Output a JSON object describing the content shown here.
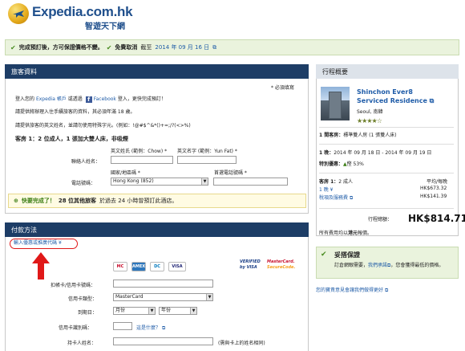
{
  "header": {
    "logo_text": "Expedia.com.hk",
    "logo_tagline": "智遊天下網"
  },
  "confirm_bar": {
    "text1": "完成預訂後，方可保證價格不變。",
    "text2": "免費取消",
    "text3": "截至",
    "date": "2014 年 09 月 16 日"
  },
  "traveler": {
    "heading": "旅客資料",
    "required_note": "* 必須填寫",
    "signin_prefix": "登入您的",
    "signin_expedia": "Expedia 帳戶",
    "signin_mid": "或透過",
    "signin_facebook": "Facebook",
    "signin_suffix": "登入，更快完成預訂！",
    "note1": "請提供將辦理入住手續旅客的資料，其必須年滿 18 歲。",
    "note2": "請提供旅客的英文姓名，並請勿使用特殊字元。(例如：!@#$^&*()+=;/?(<>%)",
    "guest_line": "客房 1：2 位成人，1 張加大雙人床，非吸煙",
    "surname_label": "英文姓氏 (範例：Chow) *",
    "givenname_label": "英文名字 (範例：Yun Fat) *",
    "name_label": "聯絡人姓名：",
    "country_code_label": "國家/地區碼 *",
    "phone_label_top": "首選電話號碼 *",
    "phone_label": "電話號碼：",
    "country_code_value": "Hong Kong (852)"
  },
  "alert": {
    "label": "快要完成了！",
    "bold": "28 位其他旅客",
    "rest": "於過去 24 小時曾預訂此酒店。"
  },
  "payment": {
    "heading": "付款方法",
    "coupon_link": "輸入優惠或推廣代碼",
    "card_number_label": "扣帳卡/信用卡號碼：",
    "card_type_label": "信用卡類型：",
    "card_type_value": "MasterCard",
    "expiry_label": "到期日：",
    "month_value": "月份",
    "year_value": "年份",
    "cvv_label": "信用卡識別碼：",
    "cvv_link": "這是什麼？",
    "holder_label": "持卡人姓名：",
    "holder_hint": "(需與卡上的姓名相同)",
    "cards": [
      "MC",
      "AMEX",
      "DC",
      "VISA"
    ],
    "verified_line1": "VERIFIED",
    "verified_line2": "by VISA",
    "mc_line1": "MasterCard.",
    "mc_line2": "SecureCode."
  },
  "summary": {
    "heading": "行程概要",
    "hotel_name_1": "Shinchon Ever8",
    "hotel_name_2": "Serviced Residence",
    "location": "Seoul, 南韓",
    "stars": "★★★★☆",
    "room_label": "1 間客房：",
    "room_value": "標準雙人房 (1 張雙人床)",
    "nights_label": "1 晚：",
    "nights_value": "2014 年 09 月 18 日 - 2014 年 09 月 19 日",
    "discount_label": "特別優惠：",
    "discount_value": "慳 53%",
    "room1_label": "客房 1：",
    "room1_value": "2 成人",
    "avg_label": "平均/每晚",
    "one_night": "1 晚",
    "price1": "HK$673.32",
    "tax_label": "稅項及服務費",
    "price2": "HK$141.39",
    "total_label": "行程總額：",
    "total_value": "HK$814.71",
    "currency_note_prefix": "所有費用均以",
    "currency_note_bold": "港元",
    "currency_note_suffix": "報價。",
    "guarantee_title": "妥搭保證",
    "guarantee_text1": "訂倉網眼需要，",
    "guarantee_link": "我們承諾",
    "guarantee_text2": "，您會獲得最低的價格。",
    "feedback_link": "您的寶貴意見會讓我們做得更好"
  },
  "colors": {
    "header_navy": "#1d3d66",
    "link_blue": "#1f5ca8",
    "confirm_green": "#eaf3dd",
    "highlight_red": "#e01818"
  }
}
